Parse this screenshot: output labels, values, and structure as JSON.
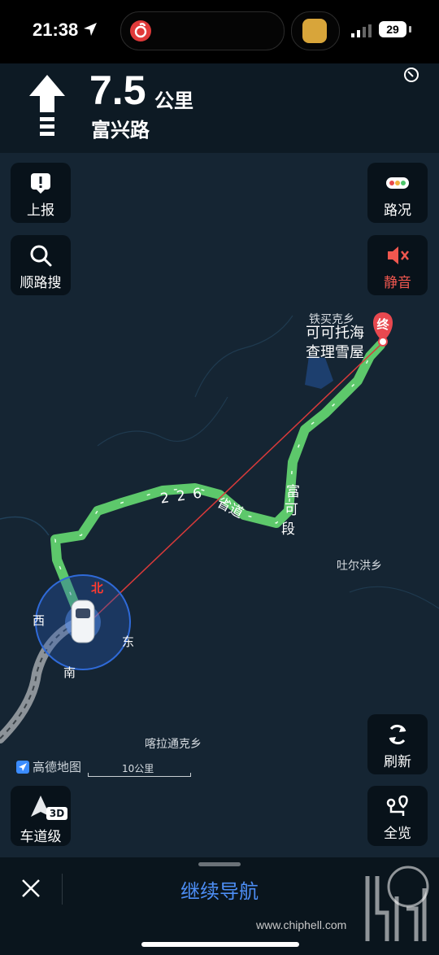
{
  "status_bar": {
    "time": "21:38",
    "battery": "29"
  },
  "navigation": {
    "distance": "7.5",
    "distance_unit": "公里",
    "next_road": "富兴路"
  },
  "left_buttons": [
    {
      "label": "上报",
      "icon": "report-icon"
    },
    {
      "label": "顺路搜",
      "icon": "search-icon"
    }
  ],
  "right_buttons": [
    {
      "label": "路况",
      "icon": "traffic-icon"
    },
    {
      "label": "静音",
      "icon": "mute-icon",
      "color": "#f0574f"
    }
  ],
  "map": {
    "destination_marker": "终",
    "destination_region": "铁买克乡",
    "destination_name_line1": "可可托海",
    "destination_name_line2": "查理雪屋",
    "road_labels": [
      "2 2 6",
      "省道",
      "富",
      "可",
      "段"
    ],
    "places": {
      "east_town": "吐尔洪乡",
      "south_town": "喀拉通克乡"
    },
    "compass": {
      "north": "北",
      "south": "南",
      "east": "东",
      "west": "西"
    },
    "brand": "高德地图",
    "scale": "10公里",
    "route_color": "#5dc86b",
    "north_color": "#ff3b30"
  },
  "bottom_left_buttons": [
    {
      "label": "车道级",
      "badge": "3D"
    }
  ],
  "bottom_right_buttons": [
    {
      "label": "刷新",
      "icon": "refresh-icon"
    },
    {
      "label": "全览",
      "icon": "overview-icon"
    }
  ],
  "bottom_bar": {
    "continue_label": "继续导航"
  },
  "watermark": {
    "url": "www.chiphell.com"
  }
}
